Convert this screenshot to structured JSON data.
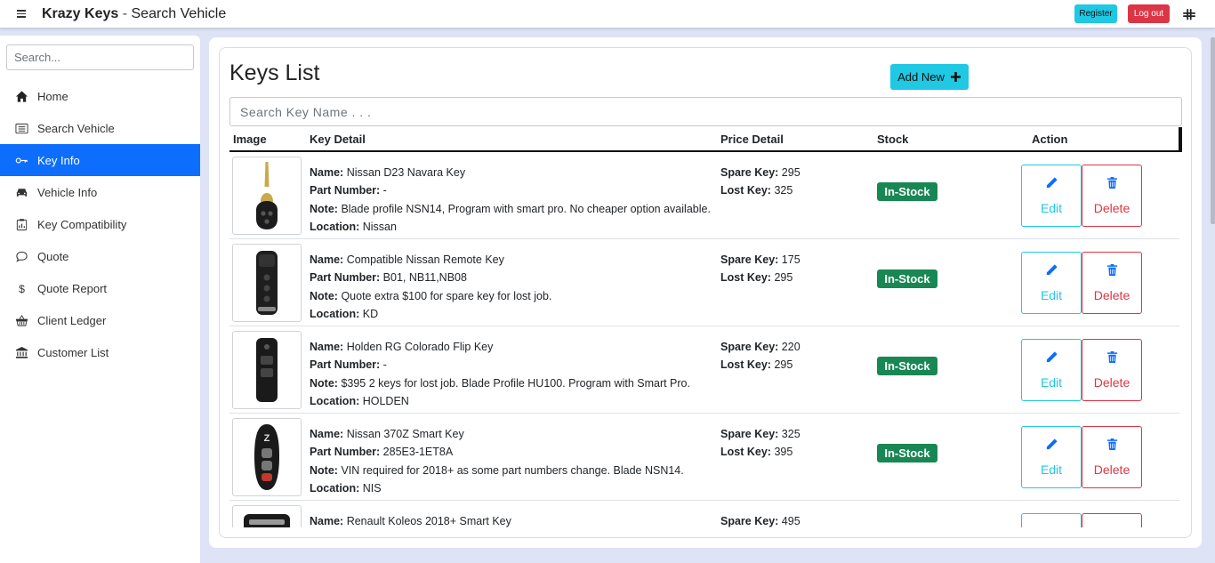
{
  "topbar": {
    "brand": "Krazy Keys",
    "separator": " - ",
    "page": "Search Vehicle",
    "register_label": "Register",
    "logout_label": "Log out"
  },
  "sidebar": {
    "search_placeholder": "Search...",
    "items": [
      {
        "label": "Home",
        "icon": "home-icon"
      },
      {
        "label": "Search Vehicle",
        "icon": "list-icon"
      },
      {
        "label": "Key Info",
        "icon": "key-icon",
        "active": true
      },
      {
        "label": "Vehicle Info",
        "icon": "car-icon"
      },
      {
        "label": "Key Compatibility",
        "icon": "clipboard-icon"
      },
      {
        "label": "Quote",
        "icon": "chat-icon"
      },
      {
        "label": "Quote Report",
        "icon": "dollar-icon"
      },
      {
        "label": "Client Ledger",
        "icon": "basket-icon"
      },
      {
        "label": "Customer List",
        "icon": "bank-icon"
      }
    ]
  },
  "main": {
    "title": "Keys List",
    "add_new_label": "Add New",
    "search_placeholder": "Search Key Name . . .",
    "columns": [
      "Image",
      "Key Detail",
      "Price Detail",
      "Stock",
      "Action"
    ],
    "labels": {
      "name": "Name:",
      "part_number": "Part Number:",
      "note": "Note:",
      "location": "Location:",
      "spare_key": "Spare Key:",
      "lost_key": "Lost Key:",
      "edit": "Edit",
      "delete": "Delete"
    },
    "rows": [
      {
        "name": "Nissan D23 Navara Key",
        "part_number": "-",
        "note": "Blade profile NSN14, Program with smart pro. No cheaper option available.",
        "location": "Nissan",
        "spare_key": "295",
        "lost_key": "325",
        "stock": "In-Stock",
        "image": "nissan-flip-key"
      },
      {
        "name": "Compatible Nissan Remote Key",
        "part_number": "B01, NB11,NB08",
        "note": "Quote extra $100 for spare key for lost job.",
        "location": "KD",
        "spare_key": "175",
        "lost_key": "295",
        "stock": "In-Stock",
        "image": "flip-remote-key"
      },
      {
        "name": "Holden RG Colorado Flip Key",
        "part_number": "-",
        "note": "$395 2 keys for lost job. Blade Profile HU100. Program with Smart Pro.",
        "location": "HOLDEN",
        "spare_key": "220",
        "lost_key": "295",
        "stock": "In-Stock",
        "image": "holden-flip-key"
      },
      {
        "name": "Nissan 370Z Smart Key",
        "part_number": "285E3-1ET8A",
        "note": "VIN required for 2018+ as some part numbers change. Blade NSN14.",
        "location": "NIS",
        "spare_key": "325",
        "lost_key": "395",
        "stock": "In-Stock",
        "image": "nissan-smart-key"
      },
      {
        "name": "Renault Koleos 2018+ Smart Key",
        "part_number": "",
        "note": "",
        "location": "",
        "spare_key": "495",
        "lost_key": "",
        "stock": "",
        "image": "renault-smart-key"
      }
    ]
  },
  "colors": {
    "primary": "#0d6efd",
    "info": "#1fc8e3",
    "danger": "#dc3545",
    "success": "#198754",
    "background": "#dfe3f6"
  }
}
